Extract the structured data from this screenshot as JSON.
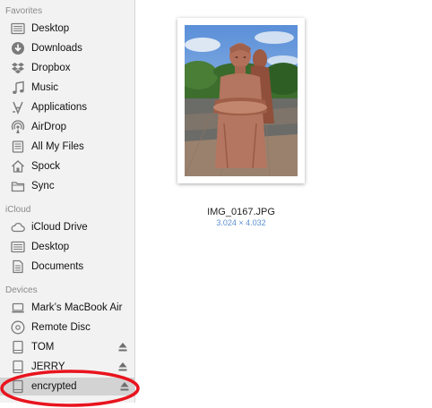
{
  "sidebar": {
    "favorites_title": "Favorites",
    "favorites": [
      {
        "label": "Desktop",
        "icon": "desktop-icon"
      },
      {
        "label": "Downloads",
        "icon": "downloads-icon"
      },
      {
        "label": "Dropbox",
        "icon": "dropbox-icon"
      },
      {
        "label": "Music",
        "icon": "music-icon"
      },
      {
        "label": "Applications",
        "icon": "applications-icon"
      },
      {
        "label": "AirDrop",
        "icon": "airdrop-icon"
      },
      {
        "label": "All My Files",
        "icon": "all-my-files-icon"
      },
      {
        "label": "Spock",
        "icon": "home-icon"
      },
      {
        "label": "Sync",
        "icon": "folder-icon"
      }
    ],
    "icloud_title": "iCloud",
    "icloud": [
      {
        "label": "iCloud Drive",
        "icon": "cloud-icon"
      },
      {
        "label": "Desktop",
        "icon": "desktop-icon"
      },
      {
        "label": "Documents",
        "icon": "documents-icon"
      }
    ],
    "devices_title": "Devices",
    "devices": [
      {
        "label": "Mark’s MacBook Air",
        "icon": "laptop-icon",
        "eject": false
      },
      {
        "label": "Remote Disc",
        "icon": "disc-icon",
        "eject": false
      },
      {
        "label": "TOM",
        "icon": "drive-icon",
        "eject": true
      },
      {
        "label": "JERRY",
        "icon": "drive-icon",
        "eject": true
      },
      {
        "label": "encrypted",
        "icon": "drive-icon",
        "eject": true,
        "selected": true
      }
    ]
  },
  "file": {
    "name": "IMG_0167.JPG",
    "dimensions": "3.024 × 4.032"
  },
  "colors": {
    "sidebar_bg": "#f2f2f2",
    "selection": "#d3d3d3",
    "accent_text": "#5b8fd0",
    "annotation_ring": "#e8141e"
  }
}
